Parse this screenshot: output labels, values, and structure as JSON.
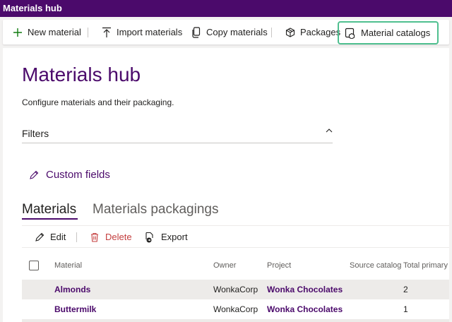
{
  "app": {
    "title": "Materials hub"
  },
  "commandbar": {
    "new_material": "New material",
    "import_materials": "Import materials",
    "copy_materials": "Copy materials",
    "packages": "Packages",
    "material_catalogs": "Material catalogs"
  },
  "page": {
    "title": "Materials hub",
    "subtitle": "Configure materials and their packaging.",
    "filters_label": "Filters",
    "custom_fields_label": "Custom fields"
  },
  "tabs": [
    {
      "label": "Materials"
    },
    {
      "label": "Materials packagings"
    }
  ],
  "grid_commands": {
    "edit": "Edit",
    "delete": "Delete",
    "export": "Export"
  },
  "table": {
    "columns": [
      "Material",
      "Owner",
      "Project",
      "Source catalog",
      "Total primary"
    ],
    "rows": [
      {
        "material": "Almonds",
        "owner": "WonkaCorp",
        "project": "Wonka Chocolates",
        "source_catalog": "",
        "total_primary": "2"
      },
      {
        "material": "Buttermilk",
        "owner": "WonkaCorp",
        "project": "Wonka Chocolates",
        "source_catalog": "",
        "total_primary": "1"
      }
    ]
  },
  "colors": {
    "brand": "#4b0a6b",
    "highlight": "#4fbf8f",
    "delete": "#c43e3e",
    "add": "#107c10"
  }
}
